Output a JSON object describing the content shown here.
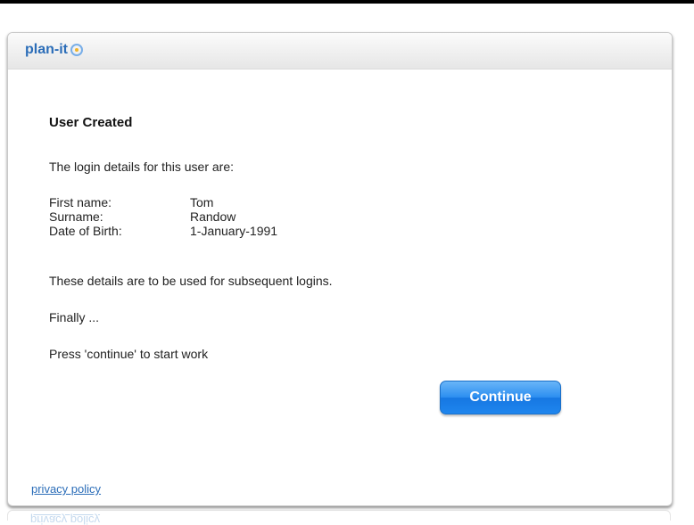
{
  "app": {
    "logo_text": "plan-it",
    "logo_mark_icon": "target-circle-icon",
    "brand_color": "#2b6db8",
    "accent_color": "#f0b42a"
  },
  "message": {
    "title": "User Created",
    "intro": "The login details for this user are:",
    "details": [
      {
        "label": "First name:",
        "value": "Tom"
      },
      {
        "label": "Surname:",
        "value": "Randow"
      },
      {
        "label": "Date of Birth:",
        "value": "1-January-1991"
      }
    ],
    "note": "These details are to be used for subsequent logins.",
    "finally": "Finally ...",
    "instruction": "Press 'continue' to start work"
  },
  "actions": {
    "continue_label": "Continue",
    "continue_color": "#2b8ef0"
  },
  "footer": {
    "privacy_label": "privacy policy"
  }
}
